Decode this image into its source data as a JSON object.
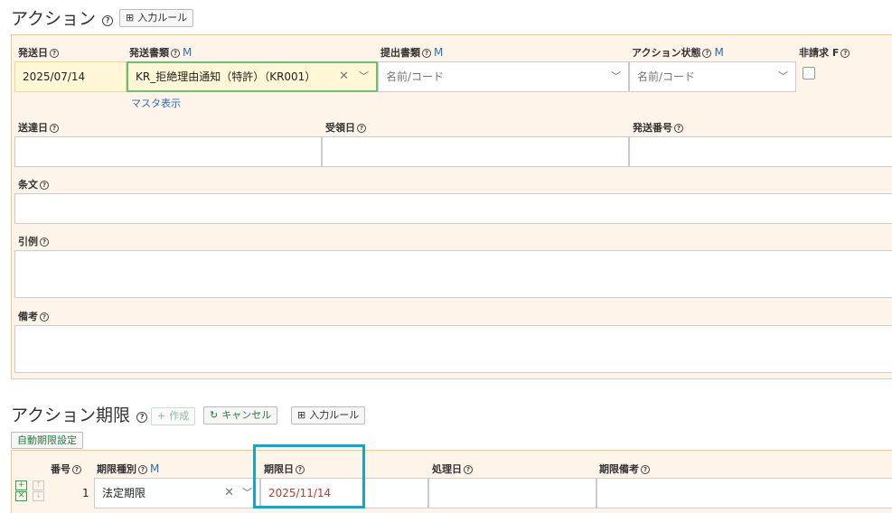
{
  "action": {
    "title": "アクション",
    "input_rule_label": "入力ルール",
    "fields": {
      "send_date": {
        "label": "発送日",
        "value": "2025/07/14"
      },
      "send_doc": {
        "label": "発送書類",
        "m": "M",
        "value": "KR_拒絶理由通知（特許）（KR001）",
        "master_link": "マスタ表示"
      },
      "submit_doc": {
        "label": "提出書類",
        "m": "M",
        "placeholder": "名前/コード"
      },
      "action_status": {
        "label": "アクション状態",
        "m": "M",
        "placeholder": "名前/コード"
      },
      "non_billing": {
        "label": "非請求 F"
      },
      "delivery_date": {
        "label": "送達日",
        "value": ""
      },
      "received_date": {
        "label": "受領日",
        "value": ""
      },
      "send_number": {
        "label": "発送番号",
        "value": ""
      },
      "article": {
        "label": "条文",
        "value": ""
      },
      "citation": {
        "label": "引例",
        "value": ""
      },
      "remarks": {
        "label": "備考",
        "value": ""
      }
    }
  },
  "deadline": {
    "title": "アクション期限",
    "create_label": "作成",
    "cancel_label": "キャンセル",
    "input_rule_label": "入力ルール",
    "auto_setting_label": "自動期限設定",
    "columns": {
      "number": "番号",
      "type": "期限種別",
      "type_m": "M",
      "due_date": "期限日",
      "processed_date": "処理日",
      "remarks": "期限備考"
    },
    "rows": [
      {
        "number": "1",
        "type": "法定期限",
        "due_date": "2025/11/14",
        "processed_date": "",
        "remarks": ""
      }
    ]
  },
  "colors": {
    "panel_bg": "#fff4ea",
    "highlight": "#1aa4c4",
    "due_date_text": "#c0392b",
    "link": "#2a6fb5"
  }
}
